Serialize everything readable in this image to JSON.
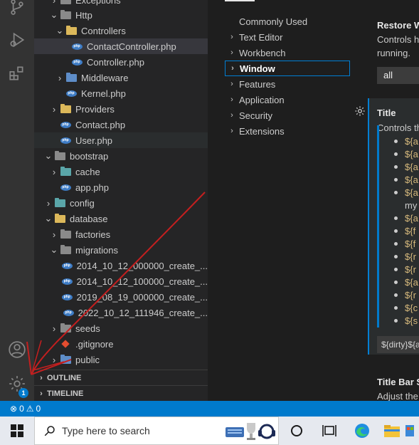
{
  "activity_bar": {
    "icons": [
      "source-control-icon",
      "run-debug-icon",
      "extensions-icon",
      "accounts-icon",
      "manage-gear-icon"
    ],
    "manage_badge": "1"
  },
  "explorer": {
    "rows": [
      {
        "label": "Exceptions",
        "type": "folder",
        "expanded": false
      },
      {
        "label": "Http",
        "type": "folder",
        "expanded": true
      },
      {
        "label": "Controllers",
        "type": "folder-yellow",
        "expanded": true
      },
      {
        "label": "ContactController.php",
        "type": "php"
      },
      {
        "label": "Controller.php",
        "type": "php"
      },
      {
        "label": "Middleware",
        "type": "folder-blue",
        "expanded": false
      },
      {
        "label": "Kernel.php",
        "type": "php"
      },
      {
        "label": "Providers",
        "type": "folder-yellow",
        "expanded": false
      },
      {
        "label": "Contact.php",
        "type": "php"
      },
      {
        "label": "User.php",
        "type": "php"
      },
      {
        "label": "bootstrap",
        "type": "folder",
        "expanded": true
      },
      {
        "label": "cache",
        "type": "folder-teal",
        "expanded": false
      },
      {
        "label": "app.php",
        "type": "php"
      },
      {
        "label": "config",
        "type": "folder-teal",
        "expanded": false
      },
      {
        "label": "database",
        "type": "folder-yellow",
        "expanded": true
      },
      {
        "label": "factories",
        "type": "folder",
        "expanded": false
      },
      {
        "label": "migrations",
        "type": "folder",
        "expanded": true
      },
      {
        "label": "2014_10_12_000000_create_...",
        "type": "php"
      },
      {
        "label": "2014_10_12_100000_create_...",
        "type": "php"
      },
      {
        "label": "2019_08_19_000000_create_...",
        "type": "php"
      },
      {
        "label": "2022_10_12_111946_create_...",
        "type": "php"
      },
      {
        "label": "seeds",
        "type": "folder",
        "expanded": false
      },
      {
        "label": ".gitignore",
        "type": "git"
      },
      {
        "label": "public",
        "type": "folder-blue",
        "expanded": false
      }
    ],
    "outline_label": "OUTLINE",
    "timeline_label": "TIMELINE"
  },
  "settings": {
    "toc": [
      {
        "label": "Commonly Used",
        "chevron": false
      },
      {
        "label": "Text Editor",
        "chevron": true
      },
      {
        "label": "Workbench",
        "chevron": true
      },
      {
        "label": "Window",
        "chevron": true,
        "active": true
      },
      {
        "label": "Features",
        "chevron": true
      },
      {
        "label": "Application",
        "chevron": true
      },
      {
        "label": "Security",
        "chevron": true
      },
      {
        "label": "Extensions",
        "chevron": true
      }
    ],
    "restore_title": "Restore W",
    "restore_desc_1": "Controls h",
    "restore_desc_2": "running.",
    "restore_value": "all",
    "title_heading": "Title",
    "title_desc": "Controls th",
    "title_vars": [
      "${a",
      "${a",
      "${a",
      "${a",
      "${a",
      "${a",
      "${f",
      "${f",
      "${r",
      "${r",
      "${a",
      "${r",
      "${c",
      "${s"
    ],
    "title_var_cont": "my",
    "title_template": "${dirty}${a",
    "titlebar_title": "Title Bar S",
    "titlebar_desc": "Adjust the"
  },
  "statusbar": {
    "errors": "0",
    "warnings": "0"
  },
  "taskbar": {
    "search_placeholder": "Type here to search"
  }
}
